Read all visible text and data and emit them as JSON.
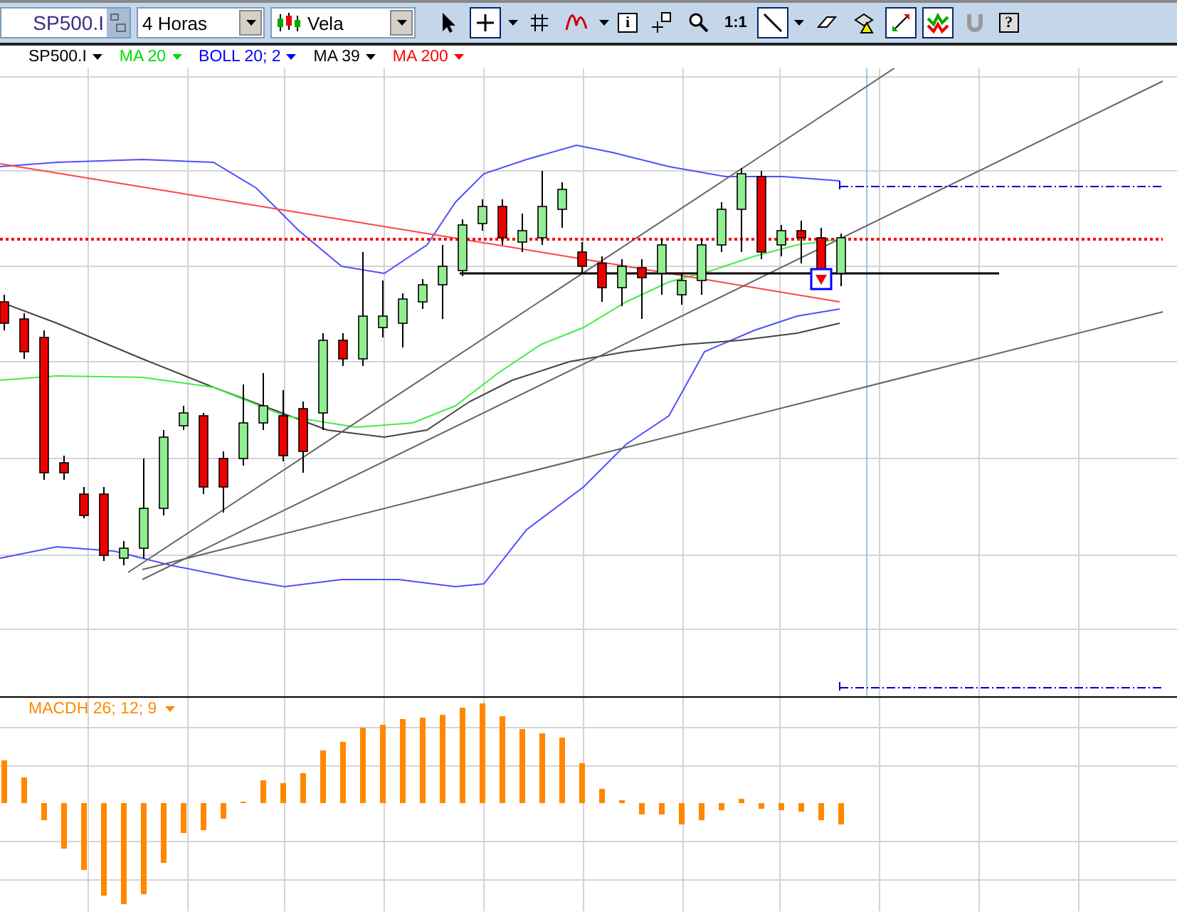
{
  "toolbar": {
    "symbol": "SP500.I",
    "interval": "4 Horas",
    "chart_type": "Vela",
    "tools": [
      {
        "kind": "pointer",
        "selected": false
      },
      {
        "kind": "crosshair",
        "selected": true
      },
      {
        "kind": "caret"
      },
      {
        "kind": "grid",
        "selected": false
      },
      {
        "kind": "indicator",
        "selected": false
      },
      {
        "kind": "caret"
      },
      {
        "kind": "info",
        "text": "i",
        "selected": false
      },
      {
        "kind": "cursorbox",
        "selected": false
      },
      {
        "kind": "zoom",
        "selected": false
      },
      {
        "kind": "ratio",
        "text": "1:1",
        "selected": false
      },
      {
        "kind": "line",
        "selected": true
      },
      {
        "kind": "caret"
      },
      {
        "kind": "eraser",
        "selected": false
      },
      {
        "kind": "alert",
        "selected": false
      },
      {
        "kind": "fit",
        "selected": true
      },
      {
        "kind": "trades",
        "selected": true
      },
      {
        "kind": "magnet",
        "selected": false
      },
      {
        "kind": "help",
        "text": "?",
        "selected": false
      }
    ]
  },
  "legend": [
    {
      "label": "SP500.I",
      "color": "#000000"
    },
    {
      "label": "MA 20",
      "color": "#00dd00"
    },
    {
      "label": "BOLL 20; 2",
      "color": "#0000ff"
    },
    {
      "label": "MA 39",
      "color": "#000000"
    },
    {
      "label": "MA 200",
      "color": "#ff0000"
    }
  ],
  "macd": {
    "label": "MACDH 26; 12; 9",
    "color": "#ff8800"
  }
}
